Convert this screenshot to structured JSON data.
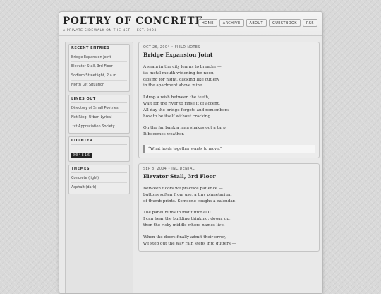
{
  "site": {
    "title": "POETRY OF CONCRETE",
    "tagline": "A PRIVATE SIDEWALK ON THE NET — EST. 2003"
  },
  "nav": [
    "HOME",
    "ARCHIVE",
    "ABOUT",
    "GUESTBOOK",
    "RSS"
  ],
  "sidebar": {
    "recent": {
      "title": "RECENT ENTRIES",
      "items": [
        "Bridge Expansion Joint",
        "Elevator Stall, 3rd Floor",
        "Sodium Streetlight, 2 a.m.",
        "North Lot Situation"
      ]
    },
    "links": {
      "title": "LINKS OUT",
      "items": [
        "Directory of Small Poetries",
        "Net Ring: Urban Lyrical",
        ".txt Appreciation Society"
      ]
    },
    "counter": {
      "title": "COUNTER",
      "value": "004816"
    },
    "themes": {
      "title": "THEMES",
      "items": [
        "Concrete (light)",
        "Asphalt (dark)"
      ]
    }
  },
  "posts": [
    {
      "meta": "OCT 26, 2004 • FIELD NOTES",
      "title": "Bridge Expansion Joint",
      "stanzas": [
        [
          "A seam in the city learns to breathe —",
          "its metal mouth widening for noon,",
          "closing for night, clicking like cutlery",
          "in the apartment above mine."
        ],
        [
          "I drop a wish between the teeth,",
          "wait for the river to rinse it of accent.",
          "All day the bridge forgets and remembers",
          "how to be itself without cracking."
        ],
        [
          "On the far bank a man shakes out a tarp.",
          "It becomes weather."
        ]
      ],
      "quote": "“What holds together wants to move.”"
    },
    {
      "meta": "SEP 8, 2004 • INCIDENTAL",
      "title": "Elevator Stall, 3rd Floor",
      "stanzas": [
        [
          "Between floors we practice patience —",
          "buttons soften from use, a tiny planetarium",
          "of thumb prints. Someone coughs a calendar."
        ],
        [
          "The panel hums in institutional C.",
          "I can hear the building thinking: down, up,",
          "then the risky middle where names live."
        ],
        [
          "When the doors finally admit their error,",
          "we step out the way rain steps into gutters —"
        ]
      ]
    }
  ]
}
